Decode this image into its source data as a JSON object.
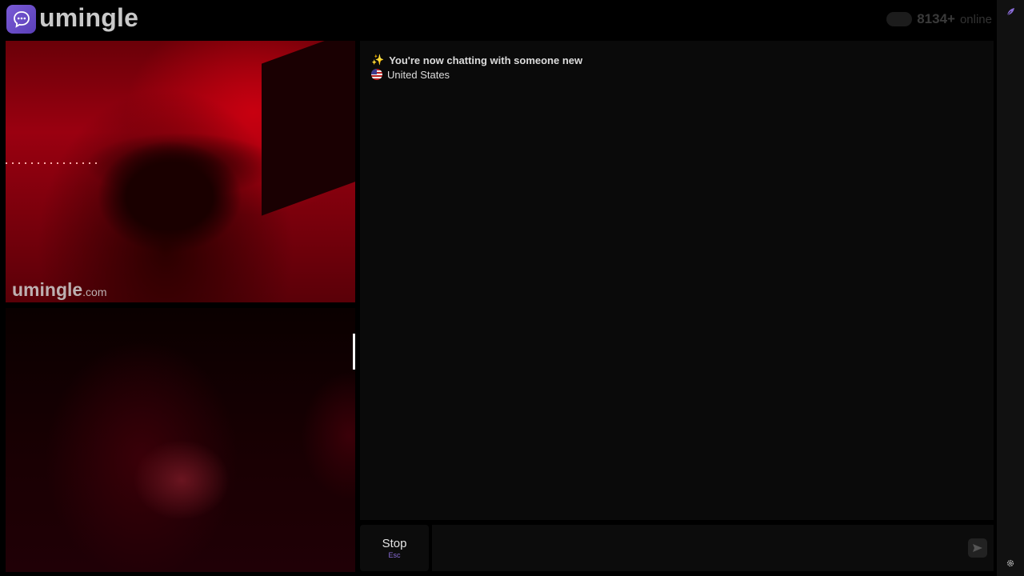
{
  "header": {
    "logo_text": "umingle",
    "online_count": "8134+",
    "online_label": "online"
  },
  "video": {
    "stranger_watermark": "umingle",
    "stranger_watermark_suffix": ".com"
  },
  "chat": {
    "status_message": "You're now chatting with someone new",
    "country": "United States"
  },
  "controls": {
    "stop_label": "Stop",
    "stop_shortcut": "Esc",
    "message_placeholder": ""
  },
  "icons": {
    "logo": "chat-bubble-icon",
    "sparkle": "sparkle-icon",
    "flag": "us-flag-icon",
    "send": "send-arrow-icon",
    "settings": "gear-icon",
    "rail_top": "feather-icon"
  },
  "colors": {
    "brand": "#6a4ccf",
    "background": "#000000",
    "panel": "#0a0a0a"
  }
}
